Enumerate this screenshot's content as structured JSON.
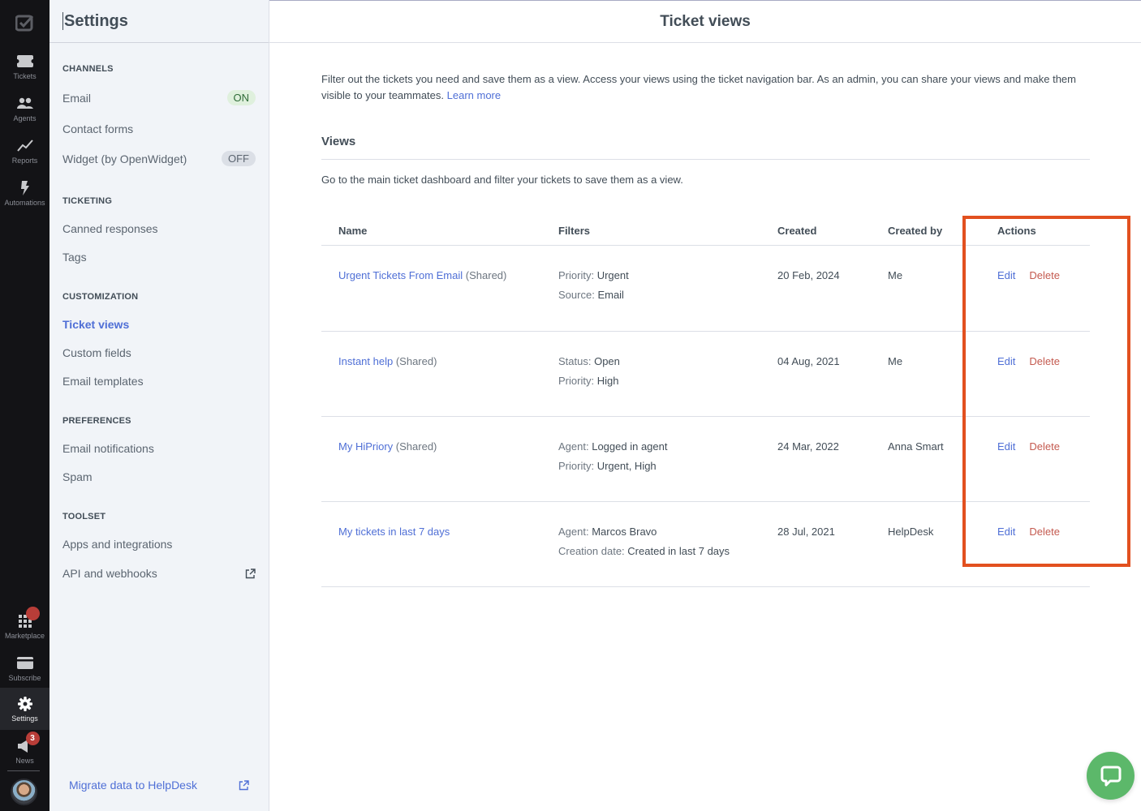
{
  "rail": {
    "logo": "helpdesk-logo",
    "top_items": [
      {
        "label": "Tickets",
        "icon": "ticket-icon"
      },
      {
        "label": "Agents",
        "icon": "agents-icon"
      },
      {
        "label": "Reports",
        "icon": "chart-line-icon"
      },
      {
        "label": "Automations",
        "icon": "lightning-icon"
      }
    ],
    "bottom_items": [
      {
        "label": "Marketplace",
        "icon": "grid-icon",
        "badge": "dot"
      },
      {
        "label": "Subscribe",
        "icon": "card-icon"
      },
      {
        "label": "Settings",
        "icon": "gear-icon",
        "active": true
      },
      {
        "label": "News",
        "icon": "megaphone-icon",
        "badge": "3"
      }
    ]
  },
  "sidebar": {
    "title": "Settings",
    "sections": [
      {
        "heading": "CHANNELS",
        "items": [
          {
            "label": "Email",
            "pill": "ON"
          },
          {
            "label": "Contact forms"
          },
          {
            "label": "Widget (by OpenWidget)",
            "pill": "OFF"
          }
        ]
      },
      {
        "heading": "TICKETING",
        "items": [
          {
            "label": "Canned responses"
          },
          {
            "label": "Tags"
          }
        ]
      },
      {
        "heading": "CUSTOMIZATION",
        "items": [
          {
            "label": "Ticket views",
            "active": true
          },
          {
            "label": "Custom fields"
          },
          {
            "label": "Email templates"
          }
        ]
      },
      {
        "heading": "PREFERENCES",
        "items": [
          {
            "label": "Email notifications"
          },
          {
            "label": "Spam"
          }
        ]
      },
      {
        "heading": "TOOLSET",
        "items": [
          {
            "label": "Apps and integrations"
          },
          {
            "label": "API and webhooks",
            "external": true
          }
        ]
      }
    ],
    "migrate_link": "Migrate data to HelpDesk"
  },
  "main": {
    "title": "Ticket views",
    "intro": "Filter out the tickets you need and save them as a view. Access your views using the ticket navigation bar. As an admin, you can share your views and make them visible to your teammates.",
    "learn_more": "Learn more",
    "views_heading": "Views",
    "views_sub": "Go to the main ticket dashboard and filter your tickets to save them as a view.",
    "columns": [
      "Name",
      "Filters",
      "Created",
      "Created by",
      "Actions"
    ],
    "rows": [
      {
        "name": "Urgent Tickets From Email",
        "shared": "(Shared)",
        "filters": [
          {
            "label": "Priority:",
            "value": "Urgent"
          },
          {
            "label": "Source:",
            "value": "Email"
          }
        ],
        "created": "20 Feb, 2024",
        "created_by": "Me",
        "edit": "Edit",
        "delete": "Delete"
      },
      {
        "name": "Instant help",
        "shared": "(Shared)",
        "filters": [
          {
            "label": "Status:",
            "value": "Open"
          },
          {
            "label": "Priority:",
            "value": "High"
          }
        ],
        "created": "04 Aug, 2021",
        "created_by": "Me",
        "edit": "Edit",
        "delete": "Delete"
      },
      {
        "name": "My HiPriory",
        "shared": "(Shared)",
        "filters": [
          {
            "label": "Agent:",
            "value": "Logged in agent"
          },
          {
            "label": "Priority:",
            "value": "Urgent, High"
          }
        ],
        "created": "24 Mar, 2022",
        "created_by": "Anna Smart",
        "edit": "Edit",
        "delete": "Delete"
      },
      {
        "name": "My tickets in last 7 days",
        "shared": "",
        "filters": [
          {
            "label": "Agent:",
            "value": "Marcos Bravo"
          },
          {
            "label": "Creation date:",
            "value": "Created in last 7 days"
          }
        ],
        "created": "28 Jul, 2021",
        "created_by": "HelpDesk",
        "edit": "Edit",
        "delete": "Delete"
      }
    ]
  },
  "colors": {
    "accent": "#4f6fd6",
    "danger": "#c45a4f",
    "highlight": "#e2501f",
    "chat": "#5cb86a",
    "rail_bg": "#131316"
  }
}
